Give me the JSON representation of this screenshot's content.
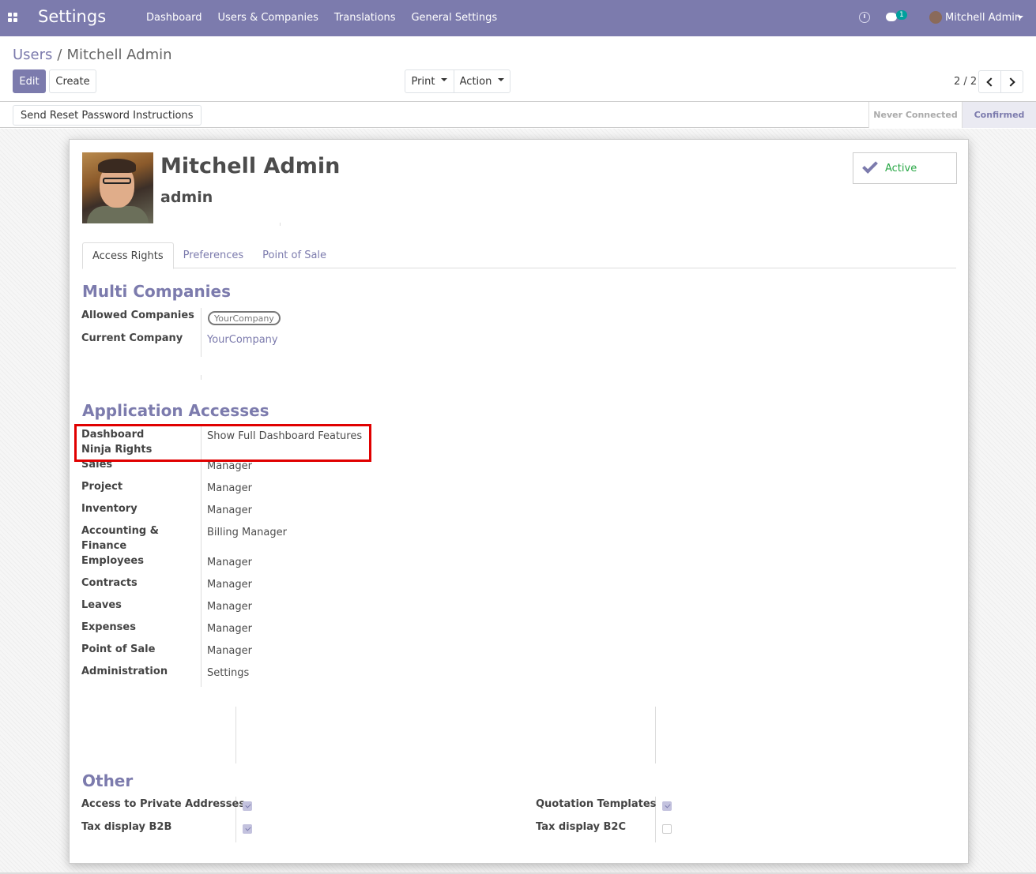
{
  "topnav": {
    "brand": "Settings",
    "menu": [
      "Dashboard",
      "Users & Companies",
      "Translations",
      "General Settings"
    ],
    "chat_count": "1",
    "user_name": "Mitchell Admin",
    "color": "#7c7bad"
  },
  "breadcrumb": {
    "parent": "Users",
    "separator": "/",
    "current": "Mitchell Admin"
  },
  "buttons": {
    "edit": "Edit",
    "create": "Create",
    "print": "Print",
    "action": "Action"
  },
  "pager": {
    "value": "2 / 2"
  },
  "statusbar": {
    "reset_button": "Send Reset Password Instructions",
    "stages": [
      "Never Connected",
      "Confirmed"
    ],
    "current_stage": "Confirmed"
  },
  "user": {
    "name": "Mitchell Admin",
    "login": "admin",
    "active_label": "Active"
  },
  "tabs": [
    "Access Rights",
    "Preferences",
    "Point of Sale"
  ],
  "multi_companies": {
    "title": "Multi Companies",
    "allowed_label": "Allowed Companies",
    "allowed_value": "YourCompany",
    "current_label": "Current Company",
    "current_value": "YourCompany"
  },
  "app_accesses": {
    "title": "Application Accesses",
    "rows": [
      {
        "label": "Dashboard Ninja Rights",
        "value": "Show Full Dashboard Features"
      },
      {
        "label": "Sales",
        "value": "Manager"
      },
      {
        "label": "Project",
        "value": "Manager"
      },
      {
        "label": "Inventory",
        "value": "Manager"
      },
      {
        "label": "Accounting & Finance",
        "value": "Billing Manager"
      },
      {
        "label": "Employees",
        "value": "Manager"
      },
      {
        "label": "Contracts",
        "value": "Manager"
      },
      {
        "label": "Leaves",
        "value": "Manager"
      },
      {
        "label": "Expenses",
        "value": "Manager"
      },
      {
        "label": "Point of Sale",
        "value": "Manager"
      },
      {
        "label": "Administration",
        "value": "Settings"
      }
    ]
  },
  "other": {
    "title": "Other",
    "left": [
      {
        "label": "Access to Private Addresses",
        "checked": true
      },
      {
        "label": "Tax display B2B",
        "checked": true
      }
    ],
    "right": [
      {
        "label": "Quotation Templates",
        "checked": true
      },
      {
        "label": "Tax display B2C",
        "checked": false
      }
    ]
  }
}
